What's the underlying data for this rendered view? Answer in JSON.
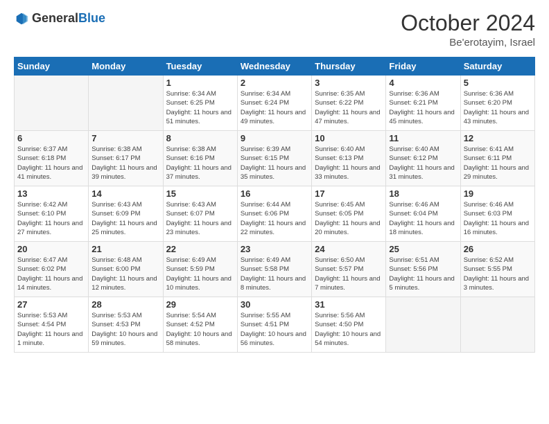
{
  "header": {
    "logo_general": "General",
    "logo_blue": "Blue",
    "month_year": "October 2024",
    "location": "Be'erotayim, Israel"
  },
  "days_of_week": [
    "Sunday",
    "Monday",
    "Tuesday",
    "Wednesday",
    "Thursday",
    "Friday",
    "Saturday"
  ],
  "weeks": [
    [
      {
        "day": "",
        "info": ""
      },
      {
        "day": "",
        "info": ""
      },
      {
        "day": "1",
        "info": "Sunrise: 6:34 AM\nSunset: 6:25 PM\nDaylight: 11 hours and 51 minutes."
      },
      {
        "day": "2",
        "info": "Sunrise: 6:34 AM\nSunset: 6:24 PM\nDaylight: 11 hours and 49 minutes."
      },
      {
        "day": "3",
        "info": "Sunrise: 6:35 AM\nSunset: 6:22 PM\nDaylight: 11 hours and 47 minutes."
      },
      {
        "day": "4",
        "info": "Sunrise: 6:36 AM\nSunset: 6:21 PM\nDaylight: 11 hours and 45 minutes."
      },
      {
        "day": "5",
        "info": "Sunrise: 6:36 AM\nSunset: 6:20 PM\nDaylight: 11 hours and 43 minutes."
      }
    ],
    [
      {
        "day": "6",
        "info": "Sunrise: 6:37 AM\nSunset: 6:18 PM\nDaylight: 11 hours and 41 minutes."
      },
      {
        "day": "7",
        "info": "Sunrise: 6:38 AM\nSunset: 6:17 PM\nDaylight: 11 hours and 39 minutes."
      },
      {
        "day": "8",
        "info": "Sunrise: 6:38 AM\nSunset: 6:16 PM\nDaylight: 11 hours and 37 minutes."
      },
      {
        "day": "9",
        "info": "Sunrise: 6:39 AM\nSunset: 6:15 PM\nDaylight: 11 hours and 35 minutes."
      },
      {
        "day": "10",
        "info": "Sunrise: 6:40 AM\nSunset: 6:13 PM\nDaylight: 11 hours and 33 minutes."
      },
      {
        "day": "11",
        "info": "Sunrise: 6:40 AM\nSunset: 6:12 PM\nDaylight: 11 hours and 31 minutes."
      },
      {
        "day": "12",
        "info": "Sunrise: 6:41 AM\nSunset: 6:11 PM\nDaylight: 11 hours and 29 minutes."
      }
    ],
    [
      {
        "day": "13",
        "info": "Sunrise: 6:42 AM\nSunset: 6:10 PM\nDaylight: 11 hours and 27 minutes."
      },
      {
        "day": "14",
        "info": "Sunrise: 6:43 AM\nSunset: 6:09 PM\nDaylight: 11 hours and 25 minutes."
      },
      {
        "day": "15",
        "info": "Sunrise: 6:43 AM\nSunset: 6:07 PM\nDaylight: 11 hours and 23 minutes."
      },
      {
        "day": "16",
        "info": "Sunrise: 6:44 AM\nSunset: 6:06 PM\nDaylight: 11 hours and 22 minutes."
      },
      {
        "day": "17",
        "info": "Sunrise: 6:45 AM\nSunset: 6:05 PM\nDaylight: 11 hours and 20 minutes."
      },
      {
        "day": "18",
        "info": "Sunrise: 6:46 AM\nSunset: 6:04 PM\nDaylight: 11 hours and 18 minutes."
      },
      {
        "day": "19",
        "info": "Sunrise: 6:46 AM\nSunset: 6:03 PM\nDaylight: 11 hours and 16 minutes."
      }
    ],
    [
      {
        "day": "20",
        "info": "Sunrise: 6:47 AM\nSunset: 6:02 PM\nDaylight: 11 hours and 14 minutes."
      },
      {
        "day": "21",
        "info": "Sunrise: 6:48 AM\nSunset: 6:00 PM\nDaylight: 11 hours and 12 minutes."
      },
      {
        "day": "22",
        "info": "Sunrise: 6:49 AM\nSunset: 5:59 PM\nDaylight: 11 hours and 10 minutes."
      },
      {
        "day": "23",
        "info": "Sunrise: 6:49 AM\nSunset: 5:58 PM\nDaylight: 11 hours and 8 minutes."
      },
      {
        "day": "24",
        "info": "Sunrise: 6:50 AM\nSunset: 5:57 PM\nDaylight: 11 hours and 7 minutes."
      },
      {
        "day": "25",
        "info": "Sunrise: 6:51 AM\nSunset: 5:56 PM\nDaylight: 11 hours and 5 minutes."
      },
      {
        "day": "26",
        "info": "Sunrise: 6:52 AM\nSunset: 5:55 PM\nDaylight: 11 hours and 3 minutes."
      }
    ],
    [
      {
        "day": "27",
        "info": "Sunrise: 5:53 AM\nSunset: 4:54 PM\nDaylight: 11 hours and 1 minute."
      },
      {
        "day": "28",
        "info": "Sunrise: 5:53 AM\nSunset: 4:53 PM\nDaylight: 10 hours and 59 minutes."
      },
      {
        "day": "29",
        "info": "Sunrise: 5:54 AM\nSunset: 4:52 PM\nDaylight: 10 hours and 58 minutes."
      },
      {
        "day": "30",
        "info": "Sunrise: 5:55 AM\nSunset: 4:51 PM\nDaylight: 10 hours and 56 minutes."
      },
      {
        "day": "31",
        "info": "Sunrise: 5:56 AM\nSunset: 4:50 PM\nDaylight: 10 hours and 54 minutes."
      },
      {
        "day": "",
        "info": ""
      },
      {
        "day": "",
        "info": ""
      }
    ]
  ]
}
